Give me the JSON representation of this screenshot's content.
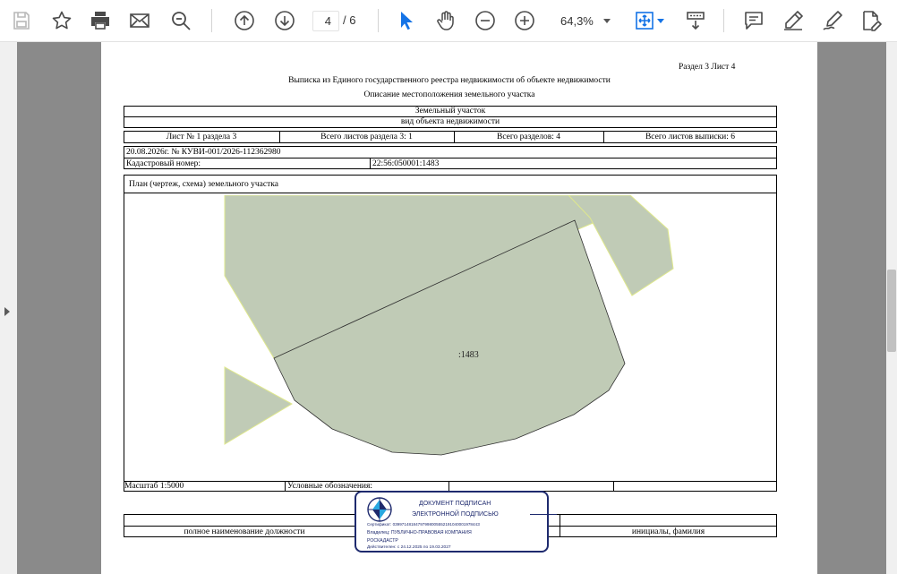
{
  "toolbar": {
    "page_current": "4",
    "page_total": "/ 6",
    "zoom": "64,3%",
    "icons": [
      "save-icon",
      "bookmark-star-icon",
      "print-icon",
      "email-icon",
      "search-icon",
      "prev-page-icon",
      "next-page-icon",
      "select-cursor-icon",
      "hand-icon",
      "zoom-out-icon",
      "zoom-in-icon",
      "fit-page-icon",
      "scroll-mode-icon",
      "comment-icon",
      "highlight-icon",
      "sign-icon",
      "edit-pdf-icon"
    ]
  },
  "colors": {
    "accent": "#1473e6",
    "parcel_fill": "#c0cbb6",
    "stamp_blue": "#1e2a6e"
  },
  "document": {
    "section_sheet": "Раздел 3    Лист 4",
    "title": "Выписка из Единого государственного реестра недвижимости об объекте недвижимости",
    "subtitle": "Описание местоположения земельного участка",
    "object_type": "Земельный участок",
    "object_caption": "вид объекта недвижимости",
    "meta": {
      "sheet": "Лист № 1 раздела 3",
      "total_section_sheets": "Всего листов раздела 3: 1",
      "total_sections": "Всего разделов: 4",
      "total_extract_sheets": "Всего листов выписки: 6"
    },
    "date_number": "20.08.2026г. № КУВИ-001/2026-112362980",
    "cadastral_label": "Кадастровый номер:",
    "cadastral_value": "22:56:050001:1483",
    "plan_label": "План (чертеж, схема) земельного участка",
    "parcel_label": ":1483",
    "scale": "Масштаб 1:5000",
    "legend_label": "Условные обозначения:",
    "footer_position": "полное наименование должности",
    "footer_initials": "инициалы, фамилия"
  },
  "stamp": {
    "line1": "ДОКУМЕНТ ПОДПИСАН",
    "line2": "ЭЛЕКТРОННОЙ ПОДПИСЬЮ",
    "certificate": "Сертификат: 0399714818479799800555219104000197844З",
    "owner1": "Владелец: ПУБЛИЧНО-ПРАВОВАЯ КОМПАНИЯ",
    "owner2": "РОСКАДАСТР",
    "validity": "Действителен: с 24.12.2025 по 19.03.2027"
  }
}
